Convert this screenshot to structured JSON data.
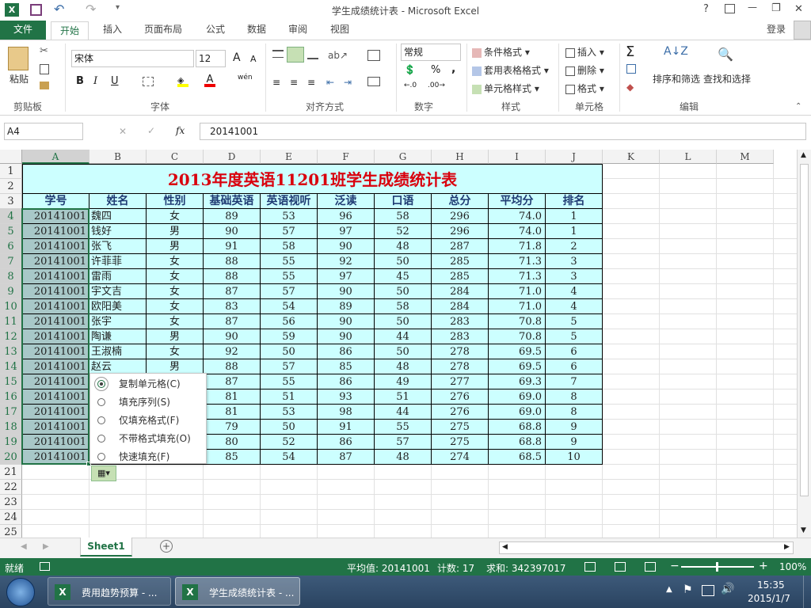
{
  "window": {
    "title": "学生成绩统计表 - Microsoft Excel",
    "help": "?",
    "minimize": "—",
    "restore": "❐",
    "close": "✕"
  },
  "qat": {
    "undo": "↶",
    "redo": "↷"
  },
  "tabs": {
    "file": "文件",
    "items": [
      "开始",
      "插入",
      "页面布局",
      "公式",
      "数据",
      "审阅",
      "视图"
    ],
    "login": "登录"
  },
  "ribbon": {
    "clipboard": {
      "paste": "粘贴",
      "label": "剪贴板"
    },
    "font": {
      "name": "宋体",
      "size": "12",
      "grow": "A",
      "shrink": "A",
      "bold": "B",
      "italic": "I",
      "underline": "U",
      "label": "字体",
      "wen": "wén"
    },
    "alignment": {
      "label": "对齐方式"
    },
    "number": {
      "format": "常规",
      "percent": "%",
      "comma": ",",
      "label": "数字"
    },
    "styles": {
      "conditional": "条件格式",
      "table": "套用表格格式",
      "cell": "单元格样式",
      "label": "样式"
    },
    "cells": {
      "insert": "插入",
      "delete": "删除",
      "format": "格式",
      "label": "单元格"
    },
    "editing": {
      "sort": "排序和筛选",
      "find": "查找和选择",
      "label": "编辑"
    }
  },
  "formula": {
    "namebox": "A4",
    "fx": "fx",
    "cancel": "✕",
    "enter": "✓",
    "value": "20141001"
  },
  "columns": [
    "A",
    "B",
    "C",
    "D",
    "E",
    "F",
    "G",
    "H",
    "I",
    "J",
    "K",
    "L",
    "M"
  ],
  "rows": [
    "1",
    "2",
    "3",
    "4",
    "5",
    "6",
    "7",
    "8",
    "9",
    "10",
    "11",
    "12",
    "13",
    "14",
    "15",
    "16",
    "17",
    "18",
    "19",
    "20",
    "21",
    "22",
    "23",
    "24",
    "25"
  ],
  "sheet": {
    "title": "2013年度英语11201班学生成绩统计表",
    "headers": [
      "学号",
      "姓名",
      "性别",
      "基础英语",
      "英语视听",
      "泛读",
      "口语",
      "总分",
      "平均分",
      "排名"
    ],
    "data": [
      [
        "20141001",
        "魏四",
        "女",
        "89",
        "53",
        "96",
        "58",
        "296",
        "74.0",
        "1"
      ],
      [
        "20141001",
        "钱好",
        "男",
        "90",
        "57",
        "97",
        "52",
        "296",
        "74.0",
        "1"
      ],
      [
        "20141001",
        "张飞",
        "男",
        "91",
        "58",
        "90",
        "48",
        "287",
        "71.8",
        "2"
      ],
      [
        "20141001",
        "许菲菲",
        "女",
        "88",
        "55",
        "92",
        "50",
        "285",
        "71.3",
        "3"
      ],
      [
        "20141001",
        "雷雨",
        "女",
        "88",
        "55",
        "97",
        "45",
        "285",
        "71.3",
        "3"
      ],
      [
        "20141001",
        "宇文吉",
        "女",
        "87",
        "57",
        "90",
        "50",
        "284",
        "71.0",
        "4"
      ],
      [
        "20141001",
        "欧阳美",
        "女",
        "83",
        "54",
        "89",
        "58",
        "284",
        "71.0",
        "4"
      ],
      [
        "20141001",
        "张宇",
        "女",
        "87",
        "56",
        "90",
        "50",
        "283",
        "70.8",
        "5"
      ],
      [
        "20141001",
        "陶谦",
        "男",
        "90",
        "59",
        "90",
        "44",
        "283",
        "70.8",
        "5"
      ],
      [
        "20141001",
        "王淑楠",
        "女",
        "92",
        "50",
        "86",
        "50",
        "278",
        "69.5",
        "6"
      ],
      [
        "20141001",
        "赵云",
        "男",
        "88",
        "57",
        "85",
        "48",
        "278",
        "69.5",
        "6"
      ],
      [
        "20141001",
        "",
        "",
        "87",
        "55",
        "86",
        "49",
        "277",
        "69.3",
        "7"
      ],
      [
        "20141001",
        "",
        "",
        "81",
        "51",
        "93",
        "51",
        "276",
        "69.0",
        "8"
      ],
      [
        "20141001",
        "",
        "",
        "81",
        "53",
        "98",
        "44",
        "276",
        "69.0",
        "8"
      ],
      [
        "20141001",
        "",
        "",
        "79",
        "50",
        "91",
        "55",
        "275",
        "68.8",
        "9"
      ],
      [
        "20141001",
        "",
        "",
        "80",
        "52",
        "86",
        "57",
        "275",
        "68.8",
        "9"
      ],
      [
        "20141001",
        "",
        "",
        "85",
        "54",
        "87",
        "48",
        "274",
        "68.5",
        "10"
      ]
    ]
  },
  "autofill": {
    "options": [
      "复制单元格(C)",
      "填充序列(S)",
      "仅填充格式(F)",
      "不带格式填充(O)",
      "快速填充(F)"
    ],
    "selected": 0
  },
  "sheettab": {
    "name": "Sheet1",
    "add": "+"
  },
  "status": {
    "ready": "就绪",
    "average": "平均值: 20141001",
    "count": "计数: 17",
    "sum": "求和: 342397017",
    "zoom": "100%"
  },
  "taskbar": {
    "items": [
      "费用趋势预算 - ...",
      "学生成绩统计表 - ..."
    ],
    "time": "15:35",
    "date": "2015/1/7"
  },
  "colors": {
    "excel_green": "#217346",
    "cell_fill": "#ccffff",
    "title_red": "#d9000d",
    "header_blue": "#1f3b73"
  }
}
